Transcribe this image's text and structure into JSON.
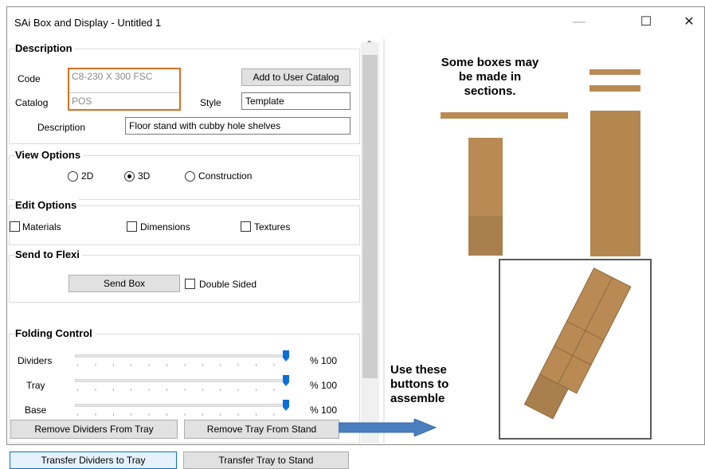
{
  "window": {
    "title": "SAi Box and Display - Untitled 1",
    "minimize": "—",
    "maximize": "☐",
    "close": "✕"
  },
  "description": {
    "title": "Description",
    "code_label": "Code",
    "code_value": "C8-230 X 300 FSC",
    "catalog_label": "Catalog",
    "catalog_value": "POS",
    "add_button": "Add to User Catalog",
    "style_label": "Style",
    "style_value": "Template",
    "desc_label": "Description",
    "desc_value": "Floor stand with cubby hole shelves"
  },
  "view_options": {
    "title": "View Options",
    "options": [
      "2D",
      "3D",
      "Construction"
    ],
    "selected": "3D"
  },
  "edit_options": {
    "title": "Edit Options",
    "options": [
      "Materials",
      "Dimensions",
      "Textures"
    ]
  },
  "send": {
    "title": "Send to Flexi",
    "send_button": "Send Box",
    "double_sided": "Double Sided"
  },
  "folding": {
    "title": "Folding Control",
    "sliders": [
      {
        "label": "Dividers",
        "value": 100,
        "display": "% 100"
      },
      {
        "label": "Tray",
        "value": 100,
        "display": "% 100"
      },
      {
        "label": "Base",
        "value": 100,
        "display": "% 100"
      }
    ],
    "remove_dividers": "Remove Dividers From Tray",
    "remove_tray": "Remove Tray From Stand"
  },
  "bottom": {
    "transfer_dividers": "Transfer Dividers to Tray",
    "transfer_tray": "Transfer Tray to Stand"
  },
  "annotations": {
    "sections_note": "Some boxes may be made in sections.",
    "sections_lines": [
      "Some boxes may",
      "be made in",
      "sections."
    ],
    "buttons_note_lines": [
      "Use these",
      "buttons to",
      "assemble"
    ]
  },
  "colors": {
    "highlight": "#d86f22",
    "accent": "#0d6fd6",
    "cardboard": "#b98a54",
    "arrow": "#4a7fc0"
  }
}
